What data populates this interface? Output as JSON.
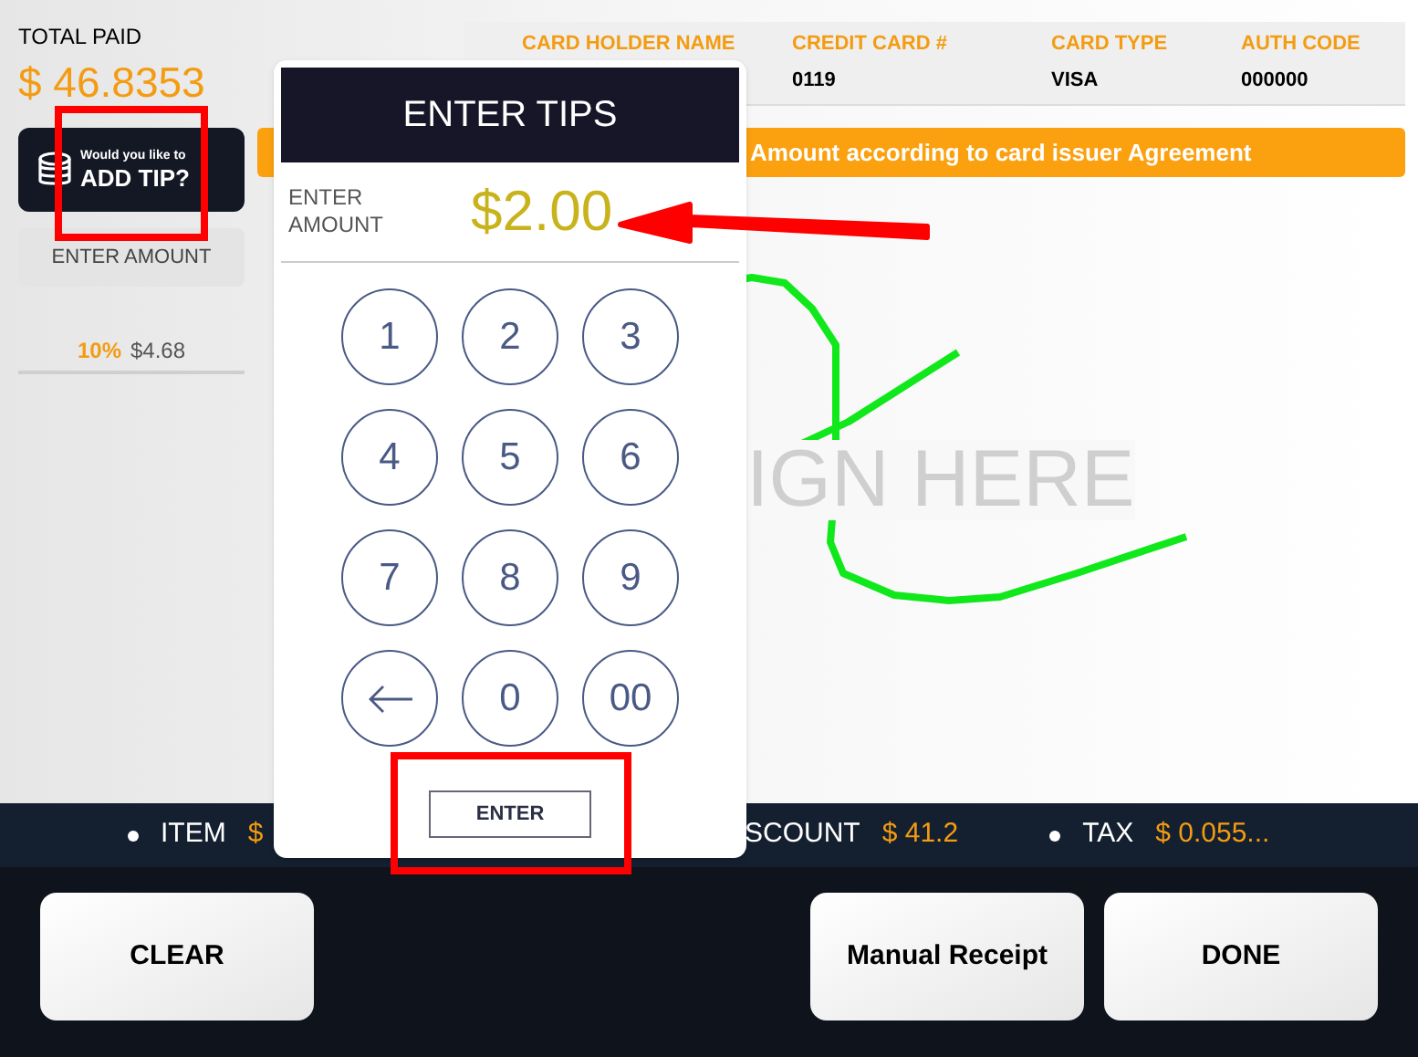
{
  "total_paid": {
    "label": "TOTAL PAID",
    "amount": "$ 46.8353"
  },
  "tip_button": {
    "line_1": "Would you like to",
    "line_2": "ADD TIP?"
  },
  "enter_amount_button": "ENTER AMOUNT",
  "tip_options": [
    {
      "percent": "10%",
      "amount": "$4.68"
    }
  ],
  "card_info": [
    {
      "label": "CARD HOLDER NAME"
    },
    {
      "label": "CREDIT CARD #",
      "value": "0119"
    },
    {
      "label": "CARD TYPE",
      "value": "VISA"
    },
    {
      "label": "AUTH CODE",
      "value": "000000"
    }
  ],
  "notice": "Amount according to card issuer Agreement",
  "signature": {
    "hint": "IGN HERE"
  },
  "tips_dialog": {
    "title": "ENTER TIPS",
    "amount_label": "ENTER AMOUNT",
    "amount": "$2.00",
    "keys": [
      {
        "kind": "digit",
        "label": "1"
      },
      {
        "kind": "digit",
        "label": "2"
      },
      {
        "kind": "digit",
        "label": "3"
      },
      {
        "kind": "digit",
        "label": "4"
      },
      {
        "kind": "digit",
        "label": "5"
      },
      {
        "kind": "digit",
        "label": "6"
      },
      {
        "kind": "digit",
        "label": "7"
      },
      {
        "kind": "digit",
        "label": "8"
      },
      {
        "kind": "digit",
        "label": "9"
      },
      {
        "kind": "backspace"
      },
      {
        "kind": "digit",
        "label": "0"
      },
      {
        "kind": "digit",
        "label": "00"
      }
    ],
    "enter_button": "ENTER"
  },
  "summary_bar": [
    {
      "label": "ITEM",
      "value": "$",
      "bullet": true
    },
    {
      "label": "SCOUNT",
      "value": "$ 41.2",
      "bullet": false
    },
    {
      "label": "TAX",
      "value": "$ 0.055...",
      "bullet": true
    }
  ],
  "actions": [
    "CLEAR",
    "Manual Receipt",
    "DONE"
  ]
}
